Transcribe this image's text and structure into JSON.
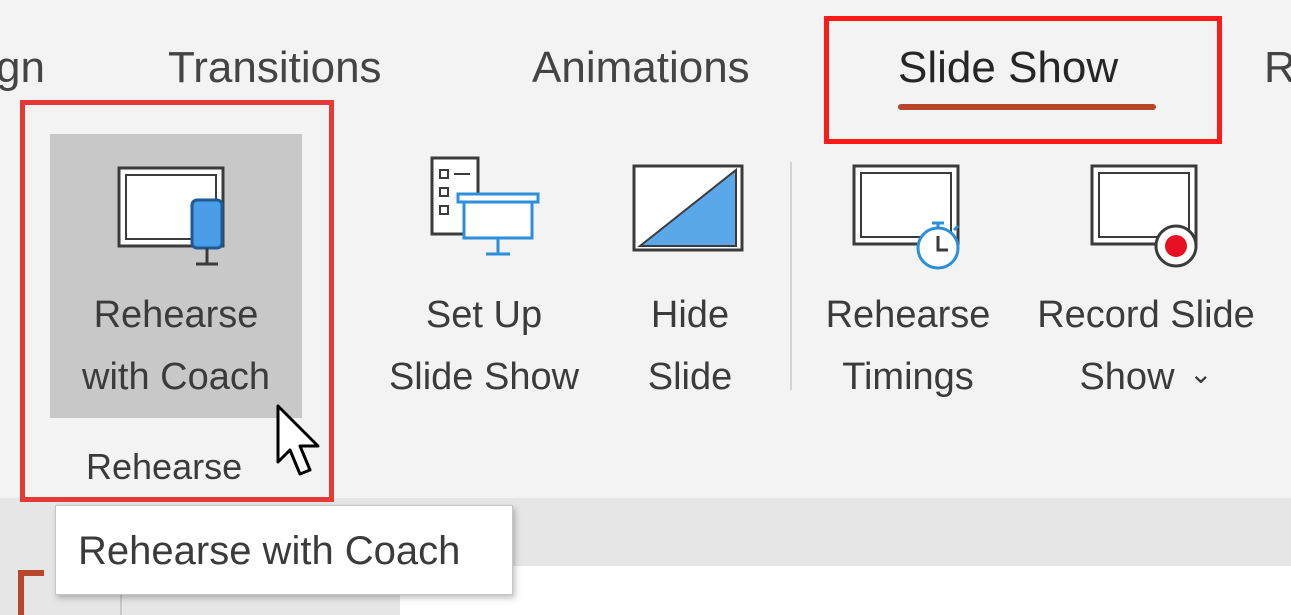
{
  "tabs": [
    {
      "label": "gn",
      "active": false
    },
    {
      "label": "Transitions",
      "active": false
    },
    {
      "label": "Animations",
      "active": false
    },
    {
      "label": "Slide Show",
      "active": true
    },
    {
      "label": "R",
      "active": false
    }
  ],
  "ribbon": {
    "buttons": [
      {
        "line1": "Rehearse",
        "line2": "with Coach",
        "icon": "rehearse-with-coach-icon",
        "hovered": true
      },
      {
        "line1": "Set Up",
        "line2": "Slide Show",
        "icon": "set-up-slide-show-icon"
      },
      {
        "line1": "Hide",
        "line2": "Slide",
        "icon": "hide-slide-icon"
      },
      {
        "line1": "Rehearse",
        "line2": "Timings",
        "icon": "rehearse-timings-icon"
      },
      {
        "line1": "Record Slide",
        "line2": "Show",
        "dropdown": "⌄",
        "icon": "record-slide-show-icon"
      }
    ],
    "group_label": "Rehearse"
  },
  "tooltip": {
    "text": "Rehearse with Coach"
  },
  "colors": {
    "accent": "#b7472a",
    "highlight_box": "#e53935",
    "icon_blue": "#4a9ee8",
    "record_red": "#e81123"
  }
}
